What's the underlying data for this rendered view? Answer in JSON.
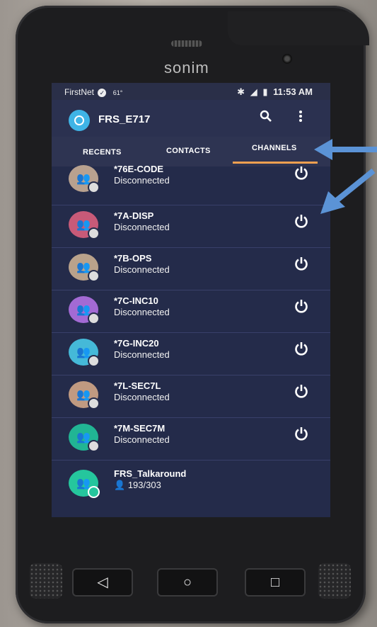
{
  "brand": "sonim",
  "status_bar": {
    "carrier": "FirstNet",
    "temperature": "61°",
    "time": "11:53 AM"
  },
  "app_bar": {
    "title": "FRS_E717",
    "icons": [
      "search-icon",
      "more-vert-icon"
    ]
  },
  "tabs": [
    {
      "label": "RECENTS"
    },
    {
      "label": "CONTACTS"
    },
    {
      "label": "CHANNELS",
      "selected": true
    }
  ],
  "channels": [
    {
      "name": "*76E-CODE",
      "status": "Disconnected",
      "avatar_color": "#b8a18f"
    },
    {
      "name": "*7A-DISP",
      "status": "Disconnected",
      "avatar_color": "#c85a78"
    },
    {
      "name": "*7B-OPS",
      "status": "Disconnected",
      "avatar_color": "#b9a28b"
    },
    {
      "name": "*7C-INC10",
      "status": "Disconnected",
      "avatar_color": "#a36ad4"
    },
    {
      "name": "*7G-INC20",
      "status": "Disconnected",
      "avatar_color": "#45b9d8"
    },
    {
      "name": "*7L-SEC7L",
      "status": "Disconnected",
      "avatar_color": "#c09a81"
    },
    {
      "name": "*7M-SEC7M",
      "status": "Disconnected",
      "avatar_color": "#21b594"
    },
    {
      "name": "FRS_Talkaround",
      "status": "193/303",
      "avatar_color": "#25c69d"
    }
  ],
  "hardware_buttons": [
    {
      "icon": "back-icon",
      "glyph": "◁"
    },
    {
      "icon": "home-icon",
      "glyph": "○"
    },
    {
      "icon": "recents-icon",
      "glyph": "□"
    }
  ],
  "annotation_color": "#5b93d6"
}
